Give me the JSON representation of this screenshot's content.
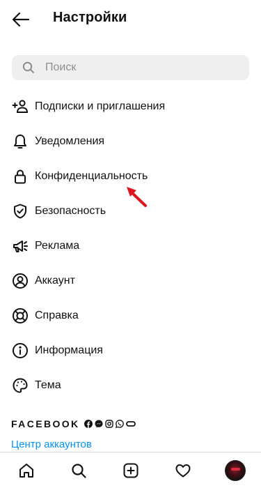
{
  "header": {
    "title": "Настройки"
  },
  "search": {
    "placeholder": "Поиск"
  },
  "menu": [
    {
      "label": "Подписки и приглашения",
      "icon": "add-person-icon"
    },
    {
      "label": "Уведомления",
      "icon": "bell-icon"
    },
    {
      "label": "Конфиденциальность",
      "icon": "lock-icon"
    },
    {
      "label": "Безопасность",
      "icon": "shield-check-icon"
    },
    {
      "label": "Реклама",
      "icon": "megaphone-icon"
    },
    {
      "label": "Аккаунт",
      "icon": "account-icon"
    },
    {
      "label": "Справка",
      "icon": "lifebuoy-icon"
    },
    {
      "label": "Информация",
      "icon": "info-icon"
    },
    {
      "label": "Тема",
      "icon": "palette-icon"
    }
  ],
  "facebook": {
    "label": "FACEBOOK",
    "icons": [
      "facebook-icon",
      "messenger-icon",
      "instagram-icon",
      "whatsapp-icon",
      "oculus-icon"
    ]
  },
  "accounts_center": {
    "label": "Центр аккаунтов"
  },
  "colors": {
    "link": "#0095f6",
    "search_bg": "#efefef",
    "annotation_arrow": "#e0141e"
  },
  "bottom_nav": [
    "home-icon",
    "search-icon",
    "create-post-icon",
    "heart-icon",
    "profile-avatar"
  ]
}
